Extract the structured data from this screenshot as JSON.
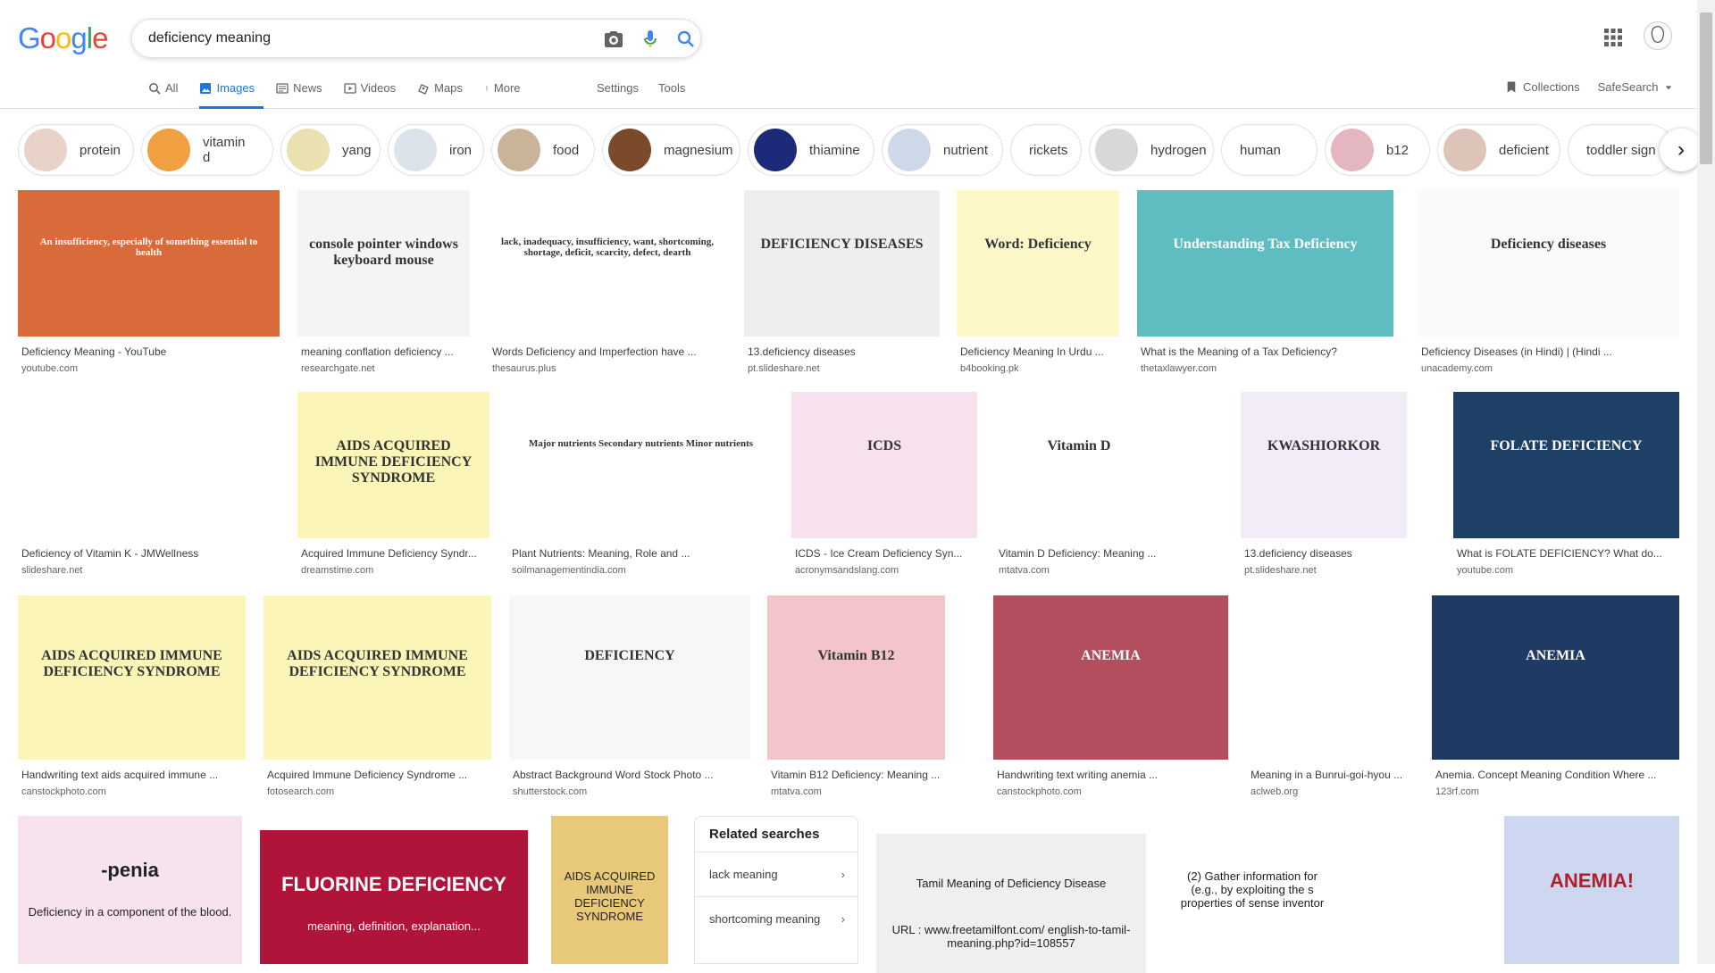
{
  "logo": "Google",
  "search": {
    "query": "deficiency meaning"
  },
  "tabs": [
    {
      "label": "All",
      "icon": "search-icon"
    },
    {
      "label": "Images",
      "icon": "image-icon",
      "active": true
    },
    {
      "label": "News",
      "icon": "news-icon"
    },
    {
      "label": "Videos",
      "icon": "video-icon"
    },
    {
      "label": "Maps",
      "icon": "map-icon"
    },
    {
      "label": "More",
      "icon": "more-vert-icon"
    }
  ],
  "settings": "Settings",
  "tools": "Tools",
  "collections": "Collections",
  "safesearch": "SafeSearch",
  "chips": [
    {
      "label": "protein",
      "color": "#e9d3c8"
    },
    {
      "label": "vitamin d",
      "color": "#f0a040"
    },
    {
      "label": "yang",
      "color": "#e9e1b0"
    },
    {
      "label": "iron",
      "color": "#dde3ea"
    },
    {
      "label": "food",
      "color": "#c9b49a"
    },
    {
      "label": "magnesium",
      "color": "#7a4a2a"
    },
    {
      "label": "thiamine",
      "color": "#1d2a7a"
    },
    {
      "label": "nutrient",
      "color": "#cfd8e8"
    },
    {
      "label": "rickets",
      "color": ""
    },
    {
      "label": "hydrogen",
      "color": "#d8d8d8"
    },
    {
      "label": "human",
      "color": ""
    },
    {
      "label": "b12",
      "color": "#e3b6c0"
    },
    {
      "label": "deficient",
      "color": "#ddc4b8"
    },
    {
      "label": "toddler sign",
      "color": ""
    }
  ],
  "results": [
    {
      "title": "Deficiency Meaning - YouTube",
      "source": "youtube.com",
      "bg": "#d96a3a",
      "caption": "An insufficiency, especially of something essential to health"
    },
    {
      "title": "meaning conflation deficiency ...",
      "source": "researchgate.net",
      "bg": "#f4f4f4",
      "caption": "console pointer windows keyboard mouse"
    },
    {
      "title": "Words Deficiency and Imperfection have ...",
      "source": "thesaurus.plus",
      "bg": "#ffffff",
      "caption": "lack, inadequacy, insufficiency, want, shortcoming, shortage, deficit, scarcity, defect, dearth"
    },
    {
      "title": "13.deficiency diseases",
      "source": "pt.slideshare.net",
      "bg": "#eeeeee",
      "caption": "DEFICIENCY DISEASES"
    },
    {
      "title": "Deficiency Meaning In Urdu ...",
      "source": "b4booking.pk",
      "bg": "#fdf8c8",
      "caption": "Word: Deficiency"
    },
    {
      "title": "What is the Meaning of a Tax Deficiency?",
      "source": "thetaxlawyer.com",
      "bg": "#5fbcc0",
      "caption": "Understanding Tax Deficiency"
    },
    {
      "title": "Deficiency Diseases (in Hindi) | (Hindi ...",
      "source": "unacademy.com",
      "bg": "#fafafa",
      "caption": "Deficiency diseases"
    },
    {
      "title": "Deficiency of Vitamin K - JMWellness",
      "source": "slideshare.net",
      "bg": "#ffffff",
      "caption": ""
    },
    {
      "title": "Acquired Immune Deficiency Syndr...",
      "source": "dreamstime.com",
      "bg": "#fbf6b8",
      "caption": "AIDS ACQUIRED IMMUNE DEFICIENCY SYNDROME"
    },
    {
      "title": "Plant Nutrients: Meaning, Role and ...",
      "source": "soilmanagementindia.com",
      "bg": "#ffffff",
      "caption": "Major nutrients   Secondary nutrients   Minor nutrients"
    },
    {
      "title": "ICDS - Ice Cream Deficiency Syn...",
      "source": "acronymsandslang.com",
      "bg": "#f7e1ef",
      "caption": "ICDS"
    },
    {
      "title": "Vitamin D Deficiency: Meaning ...",
      "source": "mtatva.com",
      "bg": "#ffffff",
      "caption": "Vitamin D"
    },
    {
      "title": "13.deficiency diseases",
      "source": "pt.slideshare.net",
      "bg": "#f1ecf7",
      "caption": "KWASHIORKOR"
    },
    {
      "title": "What is FOLATE DEFICIENCY? What do...",
      "source": "youtube.com",
      "bg": "#1e3f66",
      "caption": "FOLATE DEFICIENCY"
    },
    {
      "title": "Handwriting text aids acquired immune ...",
      "source": "canstockphoto.com",
      "bg": "#fbf6b8",
      "caption": "AIDS ACQUIRED IMMUNE DEFICIENCY SYNDROME"
    },
    {
      "title": "Acquired Immune Deficiency Syndrome ...",
      "source": "fotosearch.com",
      "bg": "#fbf6b8",
      "caption": "AIDS ACQUIRED IMMUNE DEFICIENCY SYNDROME"
    },
    {
      "title": "Abstract Background Word Stock Photo ...",
      "source": "shutterstock.com",
      "bg": "#f7f7f7",
      "caption": "DEFICIENCY"
    },
    {
      "title": "Vitamin B12 Deficiency: Meaning ...",
      "source": "mtatva.com",
      "bg": "#f3c4c9",
      "caption": "Vitamin B12"
    },
    {
      "title": "Handwriting text writing anemia ...",
      "source": "canstockphoto.com",
      "bg": "#b24e5e",
      "caption": "ANEMIA"
    },
    {
      "title": "Meaning in a Bunrui-goi-hyou ...",
      "source": "aclweb.org",
      "bg": "#ffffff",
      "caption": ""
    },
    {
      "title": "Anemia. Concept Meaning Condition Where ...",
      "source": "123rf.com",
      "bg": "#1f3a63",
      "caption": "ANEMIA"
    }
  ],
  "bottom_row": [
    {
      "bg": "#f7e3ee",
      "caption": "-penia",
      "sub": "Deficiency in a component of the blood."
    },
    {
      "bg": "#b0143b",
      "caption": "FLUORINE DEFICIENCY",
      "sub": "meaning, definition, explanation..."
    },
    {
      "bg": "#e8c97a",
      "caption": "AIDS ACQUIRED IMMUNE DEFICIENCY SYNDROME",
      "sub": ""
    },
    {
      "bg": "#efefef",
      "caption": "Tamil Meaning of Deficiency Disease",
      "sub": "URL : www.freetamilfont.com/ english-to-tamil-meaning.php?id=108557"
    },
    {
      "bg": "#ffffff",
      "caption": "(2) Gather information for (e.g., by exploiting the s properties of sense inventor",
      "sub": ""
    },
    {
      "bg": "#ffffff",
      "caption": "",
      "sub": ""
    },
    {
      "bg": "#cdd7f0",
      "caption": "ANEMIA!",
      "sub": ""
    }
  ],
  "related": {
    "heading": "Related searches",
    "items": [
      "lack meaning",
      "shortcoming meaning"
    ]
  }
}
